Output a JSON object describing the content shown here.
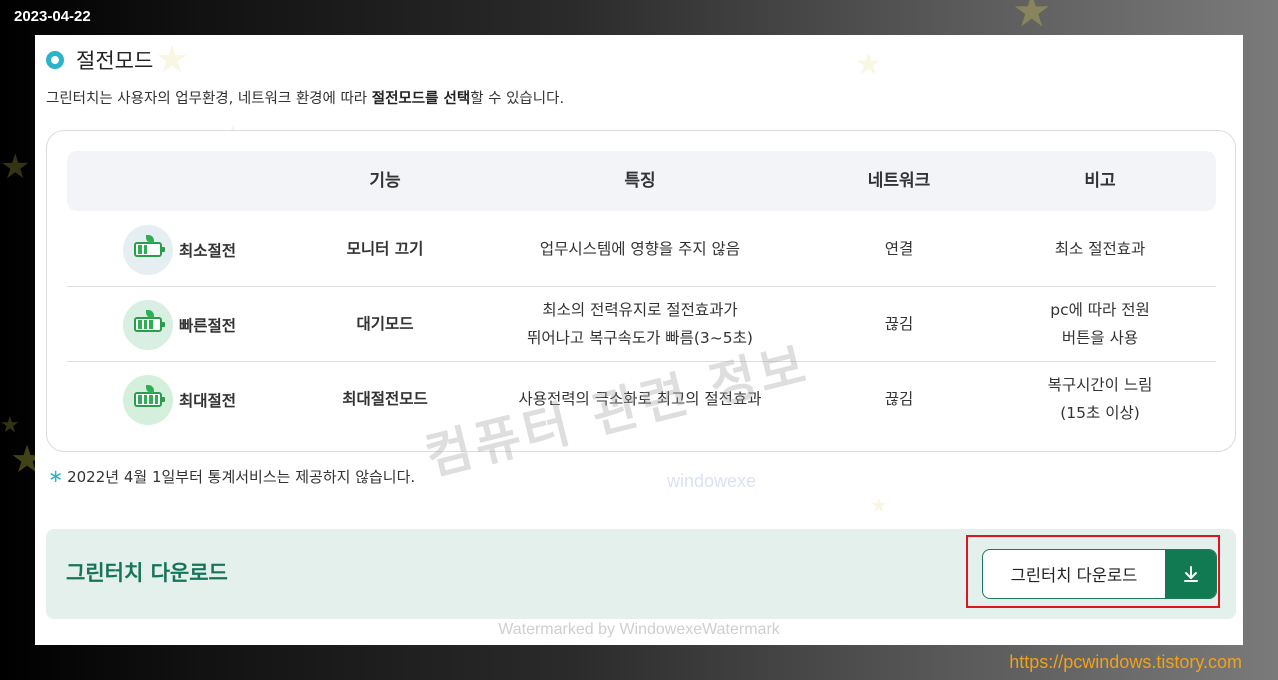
{
  "date_stamp": "2023-04-22",
  "site_url": "https://pcwindows.tistory.com",
  "section": {
    "title": "절전모드",
    "desc_parts": [
      "그린터치는 사용자의 업무환경, 네트워크 환경에 따라 ",
      "절전모드를 선택",
      "할 수 있습니다."
    ]
  },
  "table": {
    "headers": [
      "기능",
      "특징",
      "네트워크",
      "비고"
    ],
    "rows": [
      {
        "mode": "최소절전",
        "level": 1,
        "feature": "모니터 끄기",
        "description": "업무시스템에 영향을 주지 않음",
        "network": "연결",
        "note": "최소 절전효과"
      },
      {
        "mode": "빠른절전",
        "level": 2,
        "feature": "대기모드",
        "description": "최소의 전력유지로 절전효과가\n뛰어나고 복구속도가 빠름(3~5초)",
        "network": "끊김",
        "note": "pc에 따라 전원\n버튼을 사용"
      },
      {
        "mode": "최대절전",
        "level": 3,
        "feature": "최대절전모드",
        "description": "사용전력의 극소화로 최고의 절전효과",
        "network": "끊김",
        "note": "복구시간이 느림\n(15초 이상)"
      }
    ]
  },
  "footnote": {
    "mark": "∗",
    "text": "2022년 4월 1일부터 통계서비스는 제공하지 않습니다."
  },
  "download": {
    "title": "그린터치 다운로드",
    "button_label": "그린터치 다운로드",
    "icon": "download-icon"
  },
  "watermarks": {
    "overlay_big": "컴퓨터 관련 정보",
    "overlay_small": "windowexe",
    "bottom": "Watermarked by WindowexeWatermark"
  },
  "colors": {
    "accent_teal": "#2bb3c9",
    "brand_green": "#127a52",
    "banner_bg": "#e4f0ec",
    "highlight_red": "#e0141e",
    "url_orange": "#f0a21a"
  }
}
